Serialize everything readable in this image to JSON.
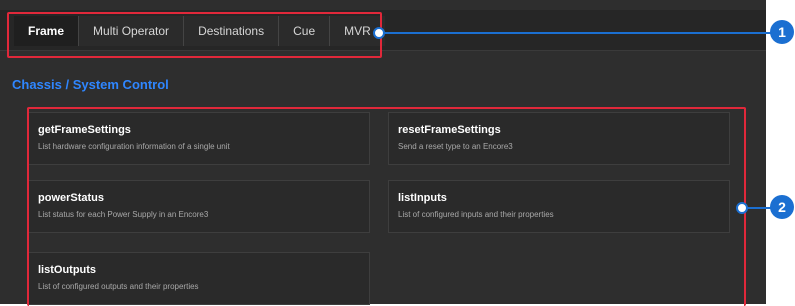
{
  "tabs": [
    {
      "label": "Frame"
    },
    {
      "label": "Multi Operator"
    },
    {
      "label": "Destinations"
    },
    {
      "label": "Cue"
    },
    {
      "label": "MVR"
    }
  ],
  "section_title": "Chassis / System Control",
  "cards": [
    {
      "name": "getFrameSettings",
      "desc": "List hardware configuration information of a single unit"
    },
    {
      "name": "resetFrameSettings",
      "desc": "Send a reset type to an Encore3"
    },
    {
      "name": "powerStatus",
      "desc": "List status for each Power Supply in an Encore3"
    },
    {
      "name": "listInputs",
      "desc": "List of configured inputs and their properties"
    },
    {
      "name": "listOutputs",
      "desc": "List of configured outputs and their properties"
    }
  ],
  "callouts": [
    "1",
    "2"
  ],
  "colors": {
    "callout_border": "#e0283a",
    "callout_marker": "#1b6fd1",
    "section_title": "#2f86ff"
  }
}
